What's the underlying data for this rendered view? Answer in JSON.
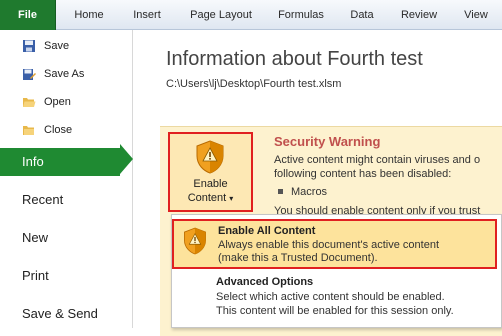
{
  "ribbon": {
    "tabs": [
      "File",
      "Home",
      "Insert",
      "Page Layout",
      "Formulas",
      "Data",
      "Review",
      "View"
    ]
  },
  "backstage": {
    "commands": [
      "Save",
      "Save As",
      "Open",
      "Close"
    ],
    "nav": [
      "Info",
      "Recent",
      "New",
      "Print",
      "Save & Send"
    ],
    "active": "Info"
  },
  "info": {
    "title": "Information about Fourth test",
    "path": "C:\\Users\\lj\\Desktop\\Fourth test.xlsm"
  },
  "security": {
    "title": "Security Warning",
    "line1": "Active content might contain viruses and o",
    "line2": "following content has been disabled:",
    "bullet": "Macros",
    "line3": "You should enable content only if you trust"
  },
  "enable_button": {
    "line1": "Enable",
    "line2": "Content"
  },
  "dropdown": {
    "option1": {
      "title": "Enable All Content",
      "desc1": "Always enable this document's active content",
      "desc2": "(make this a Trusted Document)."
    },
    "option2": {
      "title": "Advanced Options",
      "desc1": "Select which active content should be enabled.",
      "desc2": "This content will be enabled for this session only."
    }
  },
  "colors": {
    "file_tab": "#1f7a2e",
    "active_nav": "#1f8a32",
    "warning_bg": "#fdf2cf",
    "highlight_border": "#e02020",
    "warning_title": "#c0504d"
  }
}
